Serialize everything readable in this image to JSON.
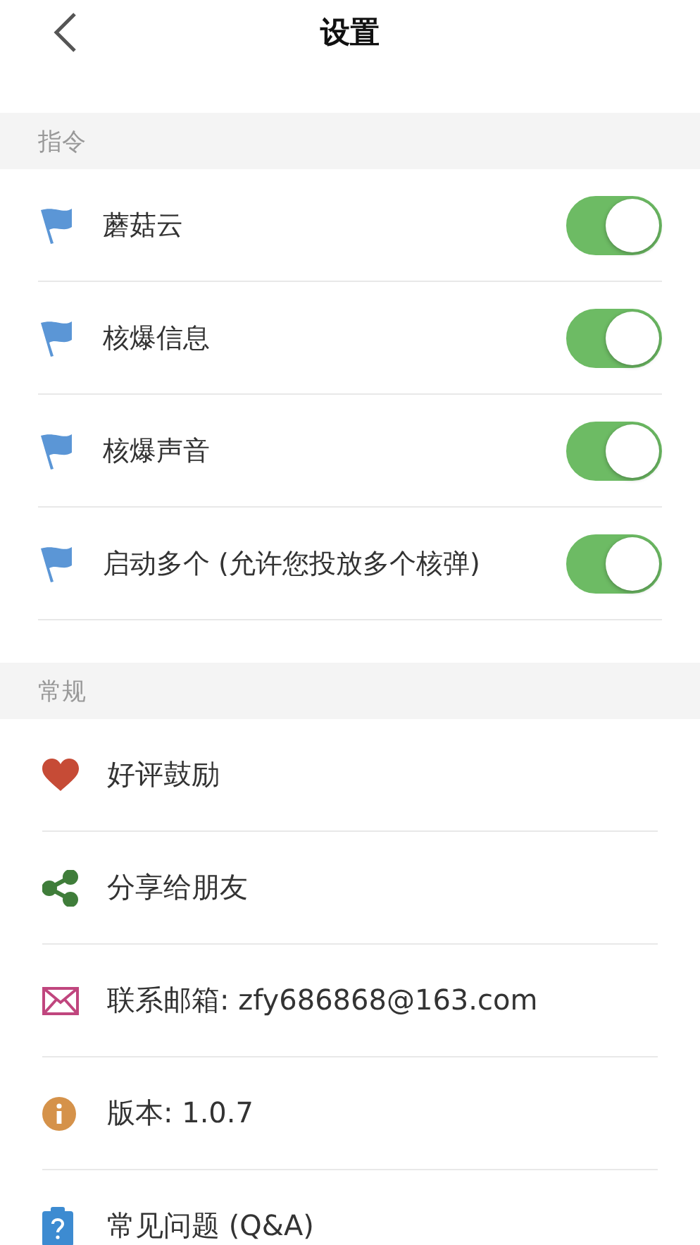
{
  "nav_bar": {
    "title": "设置"
  },
  "sections": [
    {
      "title": "指令",
      "items": [
        {
          "kind": "toggle",
          "label": "蘑菇云",
          "on": true
        },
        {
          "kind": "toggle",
          "label": "核爆信息",
          "on": true
        },
        {
          "kind": "toggle",
          "label": "核爆声音",
          "on": true
        },
        {
          "kind": "toggle",
          "label": "启动多个 (允许您投放多个核弹)",
          "on": true
        }
      ]
    },
    {
      "title": "常规",
      "items": [
        {
          "kind": "heart",
          "label": "好评鼓励"
        },
        {
          "kind": "share",
          "label": "分享给朋友"
        },
        {
          "kind": "mail",
          "label": "联系邮箱: zfy686868@163.com"
        },
        {
          "kind": "info",
          "label": "版本: 1.0.7"
        },
        {
          "kind": "help",
          "label": "常见问题 (Q&A)"
        }
      ]
    }
  ]
}
